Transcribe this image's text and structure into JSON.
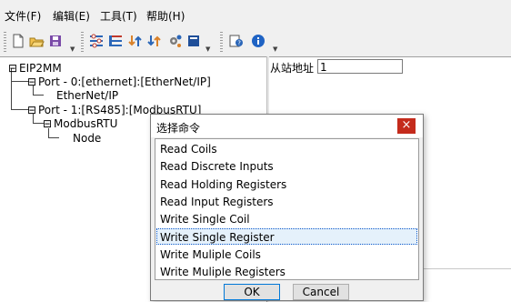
{
  "menubar": {
    "items": [
      "文件(F)",
      "编辑(E)",
      "工具(T)",
      "帮助(H)"
    ]
  },
  "toolbar": {
    "icons": [
      "new-file-icon",
      "open-folder-icon",
      "save-icon",
      "settings-list-icon",
      "list-icon",
      "transfer-icon",
      "transfer2-icon",
      "gear-icon",
      "book-icon",
      "help-icon",
      "info-icon"
    ]
  },
  "tree": {
    "root": "EIP2MM",
    "port0": "Port - 0:[ethernet]:[EtherNet/IP]",
    "ethernetip": "EtherNet/IP",
    "port1": "Port - 1:[RS485]:[ModbusRTU]",
    "modbusrtu": "ModbusRTU",
    "node": "Node"
  },
  "props": {
    "slave_label": "从站地址",
    "slave_value": "1"
  },
  "dialog": {
    "title": "选择命令",
    "close": "×",
    "items": [
      "Read Coils",
      "Read Discrete Inputs",
      "Read Holding Registers",
      "Read Input Registers",
      "Write Single Coil",
      "Write Single Register",
      "Write Muliple Coils",
      "Write Muliple Registers"
    ],
    "selected_index": 5,
    "ok": "OK",
    "cancel": "Cancel"
  },
  "colors": {
    "accent": "#0078d7",
    "close": "#c42b1c"
  }
}
